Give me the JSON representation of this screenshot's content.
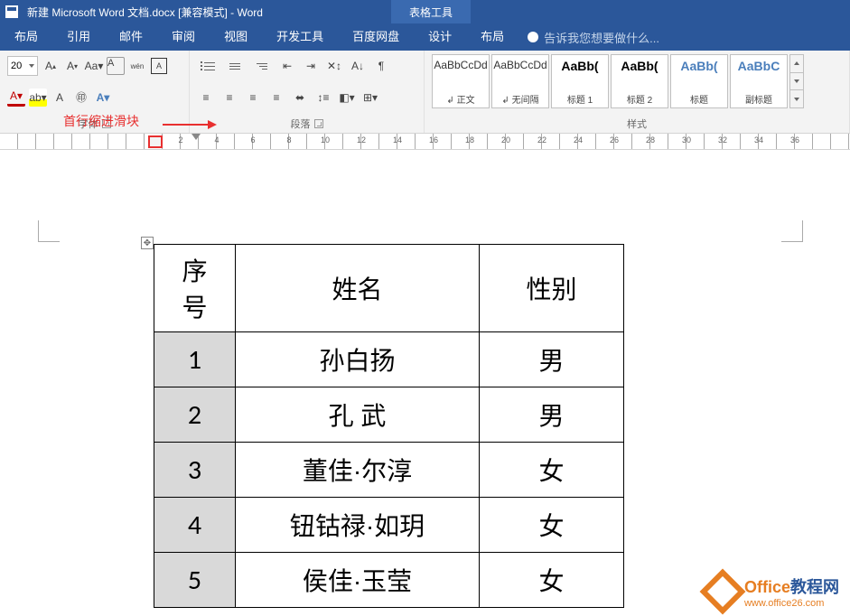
{
  "title": "新建 Microsoft Word 文档.docx [兼容模式] - Word",
  "contextual_tab_title": "表格工具",
  "menus": {
    "layout": "布局",
    "references": "引用",
    "mailings": "邮件",
    "review": "审阅",
    "view": "视图",
    "developer": "开发工具",
    "baidu": "百度网盘",
    "design": "设计",
    "table_layout": "布局"
  },
  "tell_me": "告诉我您想要做什么...",
  "ribbon": {
    "font_size": "20",
    "font_group_label": "字体",
    "clear_label": "A",
    "wen_label": "wén",
    "a_box": "A",
    "para_group_label": "段落",
    "styles_group_label": "样式",
    "styles": [
      {
        "preview": "AaBbCcDd",
        "name": "↲ 正文",
        "cls": ""
      },
      {
        "preview": "AaBbCcDd",
        "name": "↲ 无间隔",
        "cls": ""
      },
      {
        "preview": "AaBb(",
        "name": "标题 1",
        "cls": "bold"
      },
      {
        "preview": "AaBb(",
        "name": "标题 2",
        "cls": "bold"
      },
      {
        "preview": "AaBb(",
        "name": "标题",
        "cls": "blue"
      },
      {
        "preview": "AaBbC",
        "name": "副标题",
        "cls": "blue"
      }
    ]
  },
  "annotation": "首行缩进滑块",
  "ruler_numbers": [
    "2",
    "4",
    "6",
    "8",
    "10",
    "12",
    "14",
    "16",
    "18",
    "20",
    "22",
    "24",
    "26",
    "28",
    "30",
    "32",
    "34",
    "36"
  ],
  "table": {
    "headers": {
      "num": "序号",
      "name": "姓名",
      "gender": "性别"
    },
    "rows": [
      {
        "num": "1",
        "name": "孙白扬",
        "gender": "男"
      },
      {
        "num": "2",
        "name": "孔 武",
        "gender": "男"
      },
      {
        "num": "3",
        "name": "董佳·尔淳",
        "gender": "女"
      },
      {
        "num": "4",
        "name": "钮钴禄·如玥",
        "gender": "女"
      },
      {
        "num": "5",
        "name": "侯佳·玉莹",
        "gender": "女"
      }
    ]
  },
  "watermark": {
    "brand_a": "Office",
    "brand_b": "教程网",
    "url": "www.office26.com"
  }
}
